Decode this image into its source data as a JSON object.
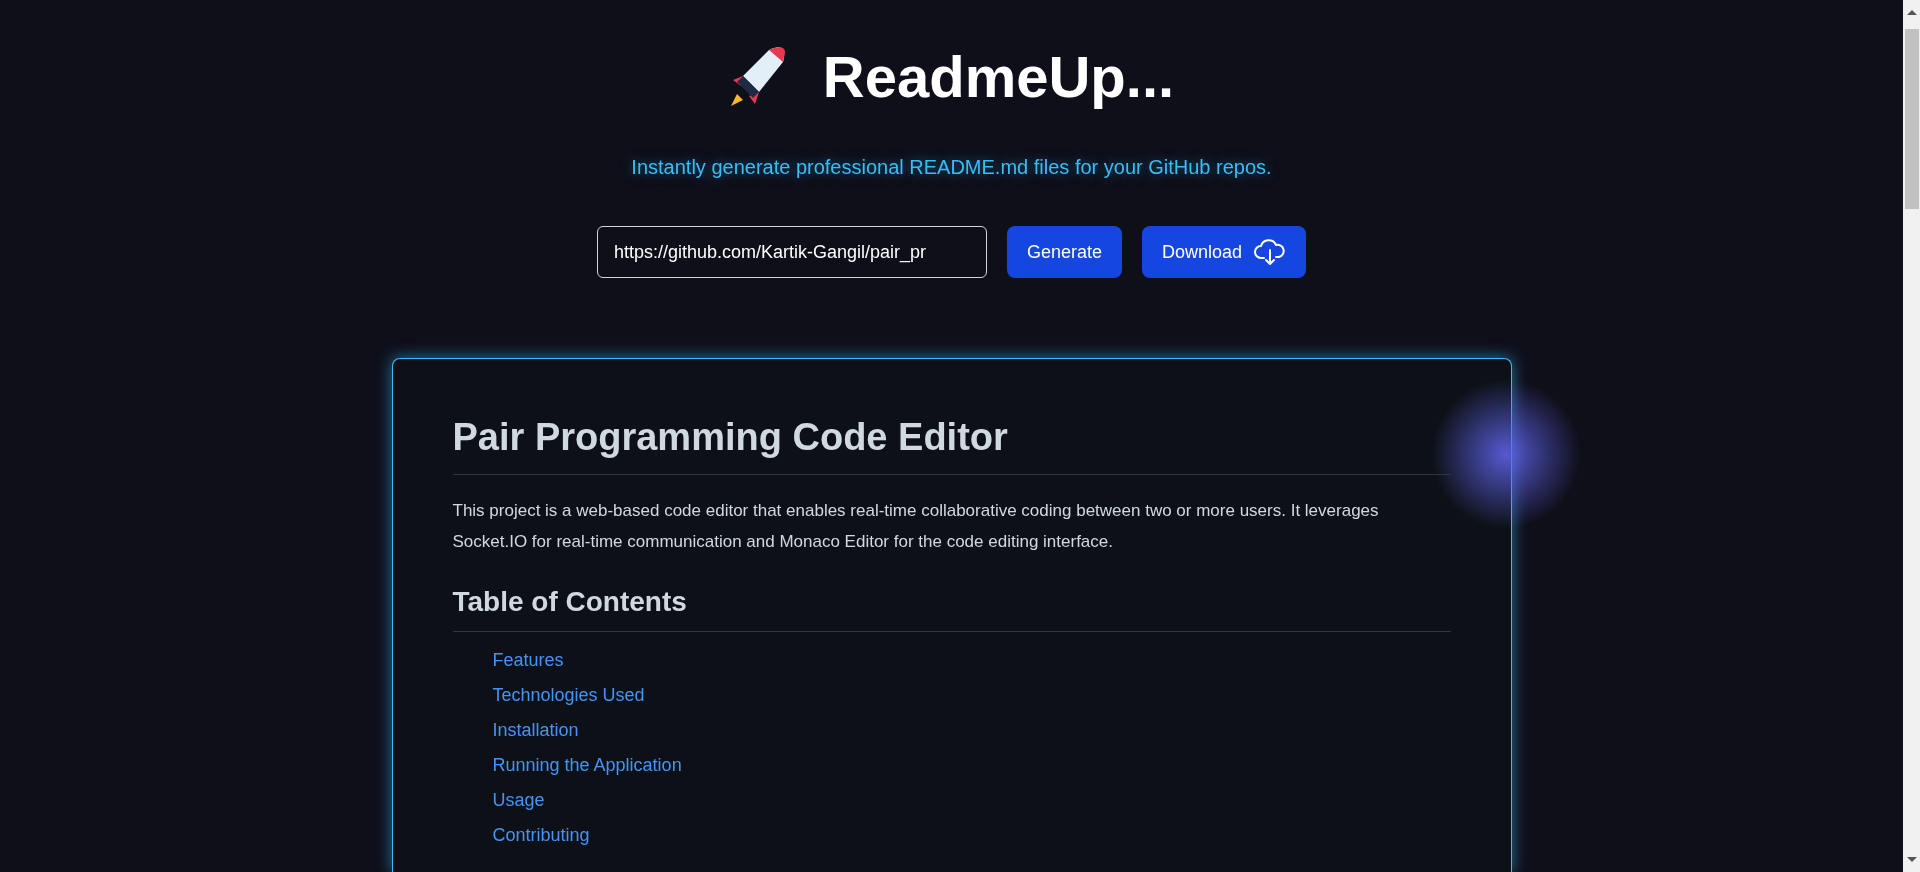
{
  "header": {
    "title": "ReadmeUp...",
    "tagline": "Instantly generate professional README.md files for your GitHub repos."
  },
  "form": {
    "repo_url": "https://github.com/Kartik-Gangil/pair_pr",
    "buttons": [
      {
        "label": "Generate",
        "kind": "plain"
      },
      {
        "label": "Download",
        "kind": "download"
      }
    ]
  },
  "readme": {
    "title": "Pair Programming Code Editor",
    "intro": "This project is a web-based code editor that enables real-time collaborative coding between two or more users. It leverages Socket.IO for real-time communication and Monaco Editor for the code editing interface.",
    "toc_heading": "Table of Contents",
    "toc": [
      "Features",
      "Technologies Used",
      "Installation",
      "Running the Application",
      "Usage",
      "Contributing"
    ]
  }
}
